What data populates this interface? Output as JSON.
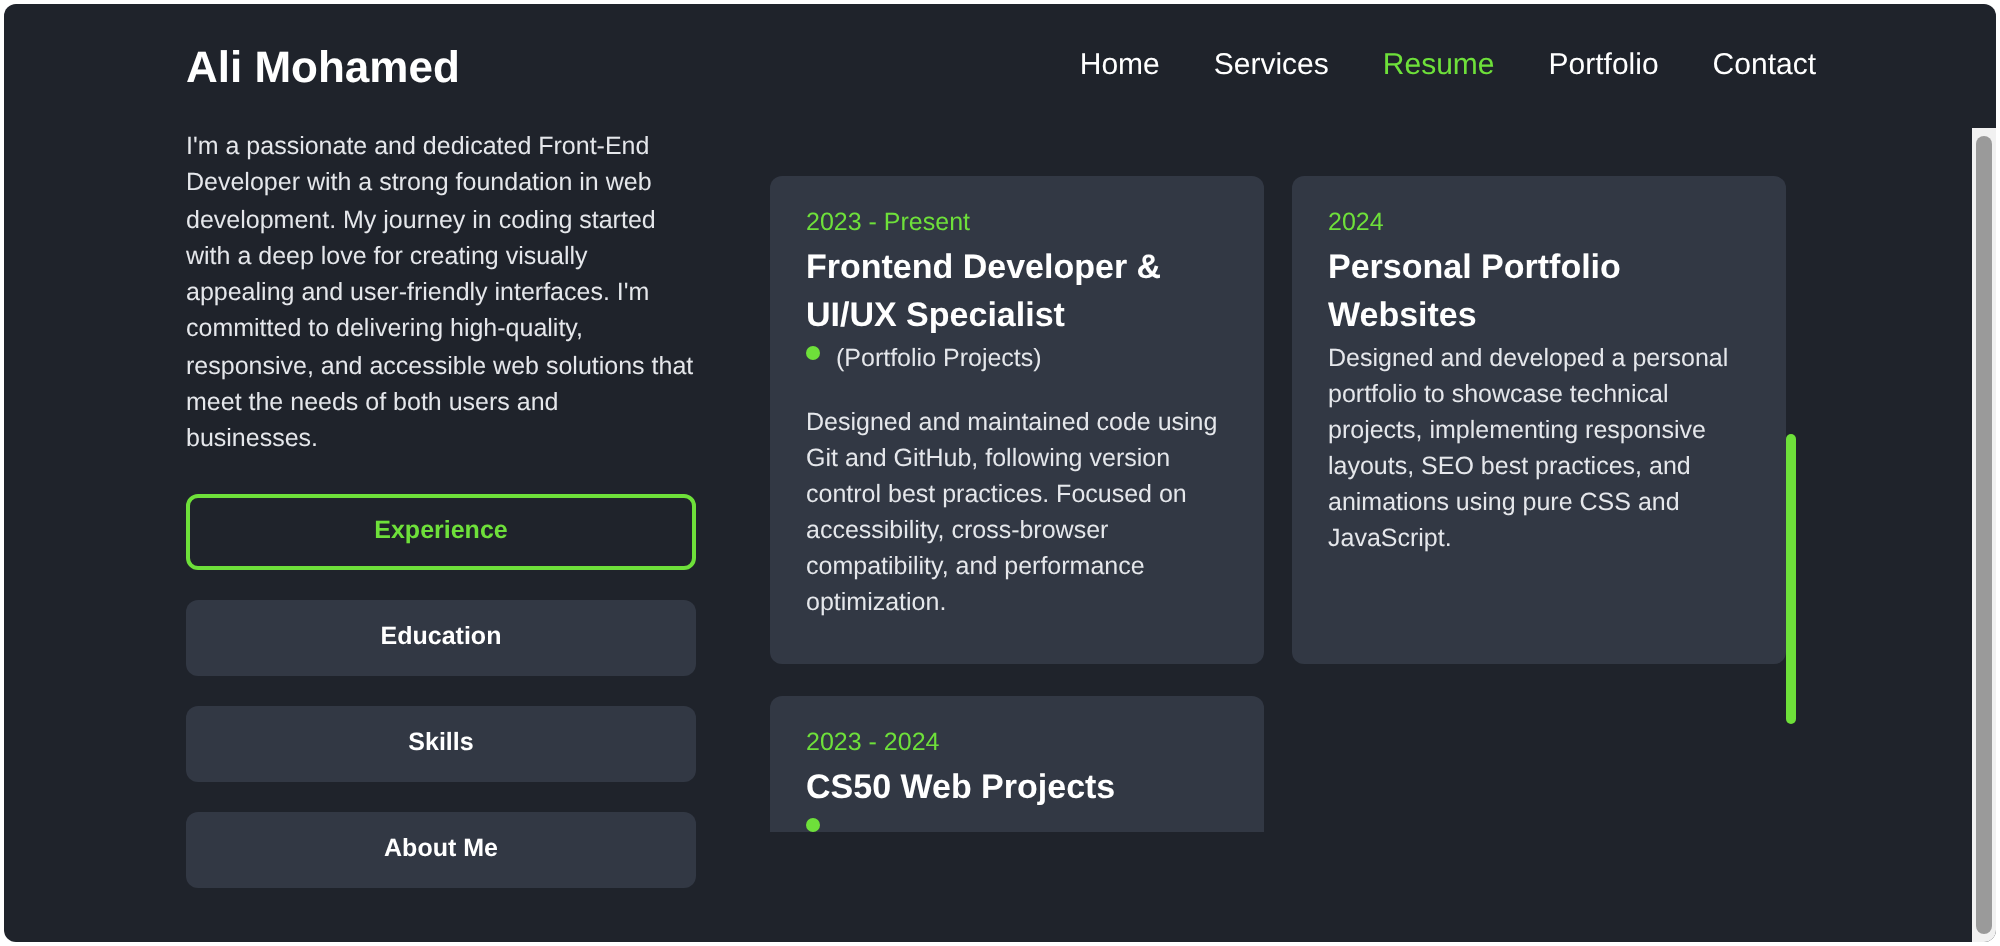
{
  "header": {
    "name": "Ali Mohamed",
    "nav": [
      {
        "label": "Home",
        "selected": false
      },
      {
        "label": "Services",
        "selected": false
      },
      {
        "label": "Resume",
        "selected": true
      },
      {
        "label": "Portfolio",
        "selected": false
      },
      {
        "label": "Contact",
        "selected": false
      }
    ]
  },
  "about": "I'm a passionate and dedicated Front-End Developer with a strong foundation in web development. My journey in coding started with a deep love for creating visually appealing and user-friendly interfaces. I'm committed to delivering high-quality, responsive, and accessible web solutions that meet the needs of both users and businesses.",
  "tabs": [
    {
      "label": "Experience",
      "selected": true
    },
    {
      "label": "Education",
      "selected": false
    },
    {
      "label": "Skills",
      "selected": false
    },
    {
      "label": "About Me",
      "selected": false
    }
  ],
  "cards": [
    {
      "date": "2023 - Present",
      "title": "Frontend Developer & UI/UX Specialist",
      "dot": true,
      "note": "(Portfolio Projects)",
      "description": "Designed and maintained code using Git and GitHub, following version control best practices. Focused on accessibility, cross-browser compatibility, and performance optimization."
    },
    {
      "date": "2024",
      "title": "Personal Portfolio Websites",
      "dot": false,
      "description": "Designed and developed a personal portfolio to showcase technical projects, implementing responsive layouts, SEO best practices, and animations using pure CSS and JavaScript."
    },
    {
      "date": "2023 - 2024",
      "title": "CS50 Web Projects",
      "dot": true
    }
  ]
}
